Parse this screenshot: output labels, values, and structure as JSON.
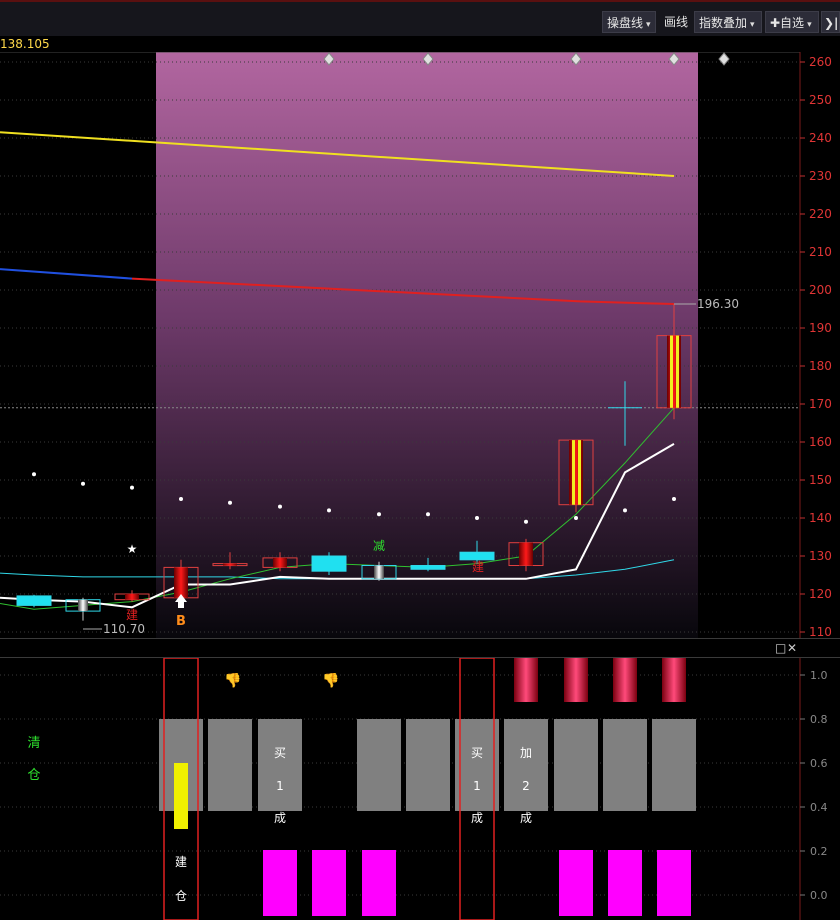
{
  "toolbar": {
    "operate_line": "操盘线",
    "draw_line": "画线",
    "index_overlay": "指数叠加",
    "watchlist": "✚自选",
    "collapse": "❯|"
  },
  "chart": {
    "current_price": "138.105",
    "high_label": "196.30",
    "low_label": "110.70",
    "buy_marker": "B",
    "markers": {
      "build": "建",
      "reduce": "减"
    }
  },
  "chart_data": {
    "type": "candlestick",
    "y_axis": {
      "min": 110,
      "max": 260,
      "ticks": [
        110,
        120,
        130,
        140,
        150,
        160,
        170,
        180,
        190,
        200,
        210,
        220,
        230,
        240,
        250,
        260
      ]
    },
    "reference_line": 169,
    "candles": [
      {
        "open": 117,
        "close": 119.5,
        "high": 119.8,
        "low": 116.5,
        "color": "cyan"
      },
      {
        "open": 118.5,
        "close": 115.5,
        "high": 119,
        "low": 113,
        "color": "silver"
      },
      {
        "open": 120,
        "close": 118.5,
        "high": 121,
        "low": 118,
        "color": "red"
      },
      {
        "open": 119,
        "close": 127,
        "high": 129,
        "low": 117,
        "color": "red"
      },
      {
        "open": 127.5,
        "close": 128,
        "high": 131,
        "low": 126.5,
        "color": "red"
      },
      {
        "open": 127,
        "close": 129.5,
        "high": 131,
        "low": 126,
        "color": "red"
      },
      {
        "open": 130,
        "close": 126,
        "high": 131,
        "low": 125,
        "color": "cyan"
      },
      {
        "open": 127.5,
        "close": 124,
        "high": 128.5,
        "low": 123.5,
        "color": "silver"
      },
      {
        "open": 127.5,
        "close": 126.5,
        "high": 129.5,
        "low": 126,
        "color": "cyan"
      },
      {
        "open": 131,
        "close": 129,
        "high": 134,
        "low": 128,
        "color": "cyan"
      },
      {
        "open": 127.5,
        "close": 133.5,
        "high": 134.5,
        "low": 126,
        "color": "red"
      },
      {
        "open": 143.5,
        "close": 160.5,
        "high": 160.5,
        "low": 141.5,
        "color": "red"
      },
      {
        "open": 169,
        "close": 169,
        "high": 176,
        "low": 159,
        "color": "cyan"
      },
      {
        "open": 169,
        "close": 188,
        "high": 196.3,
        "low": 166,
        "color": "red"
      }
    ],
    "white_line": [
      123.5,
      119,
      118.5,
      118,
      116.5,
      122.5,
      122.5,
      124.5,
      124,
      124,
      124,
      124,
      124,
      126.5,
      152,
      159.5
    ],
    "green_line": [
      117.5,
      116,
      117,
      118,
      120.5,
      124,
      127,
      128,
      127.5,
      127,
      128,
      130,
      141,
      154.5,
      169
    ],
    "cyan_line": [
      125.5,
      125,
      124.5,
      124.5,
      124.5,
      124.5,
      124,
      124,
      124,
      124,
      124,
      124,
      125,
      126.5,
      129
    ],
    "yellow_line": [
      241.5,
      230
    ],
    "ma_blue_red": [
      205.5,
      196.3
    ],
    "white_dots": [
      151.5,
      149,
      148,
      145,
      144,
      143,
      142,
      141,
      141,
      140,
      139,
      140,
      142,
      145
    ]
  },
  "sub_chart": {
    "left_label_1": "清",
    "left_label_2": "仓",
    "y_axis": [
      "1.0",
      "0.8",
      "0.6",
      "0.4",
      "0.2",
      "0.0"
    ],
    "box1_text": [
      "建",
      "仓"
    ],
    "box2_text": [
      "买",
      "1",
      "成"
    ],
    "col_text_buy": [
      "买",
      "1",
      "成"
    ],
    "col_text_add": [
      "加",
      "2",
      "成"
    ]
  },
  "colors": {
    "accent_red": "#e02020",
    "cyan": "#20e0f0",
    "magenta": "#ff00ff",
    "yellow": "#f0f000",
    "gray_block": "#808080"
  }
}
